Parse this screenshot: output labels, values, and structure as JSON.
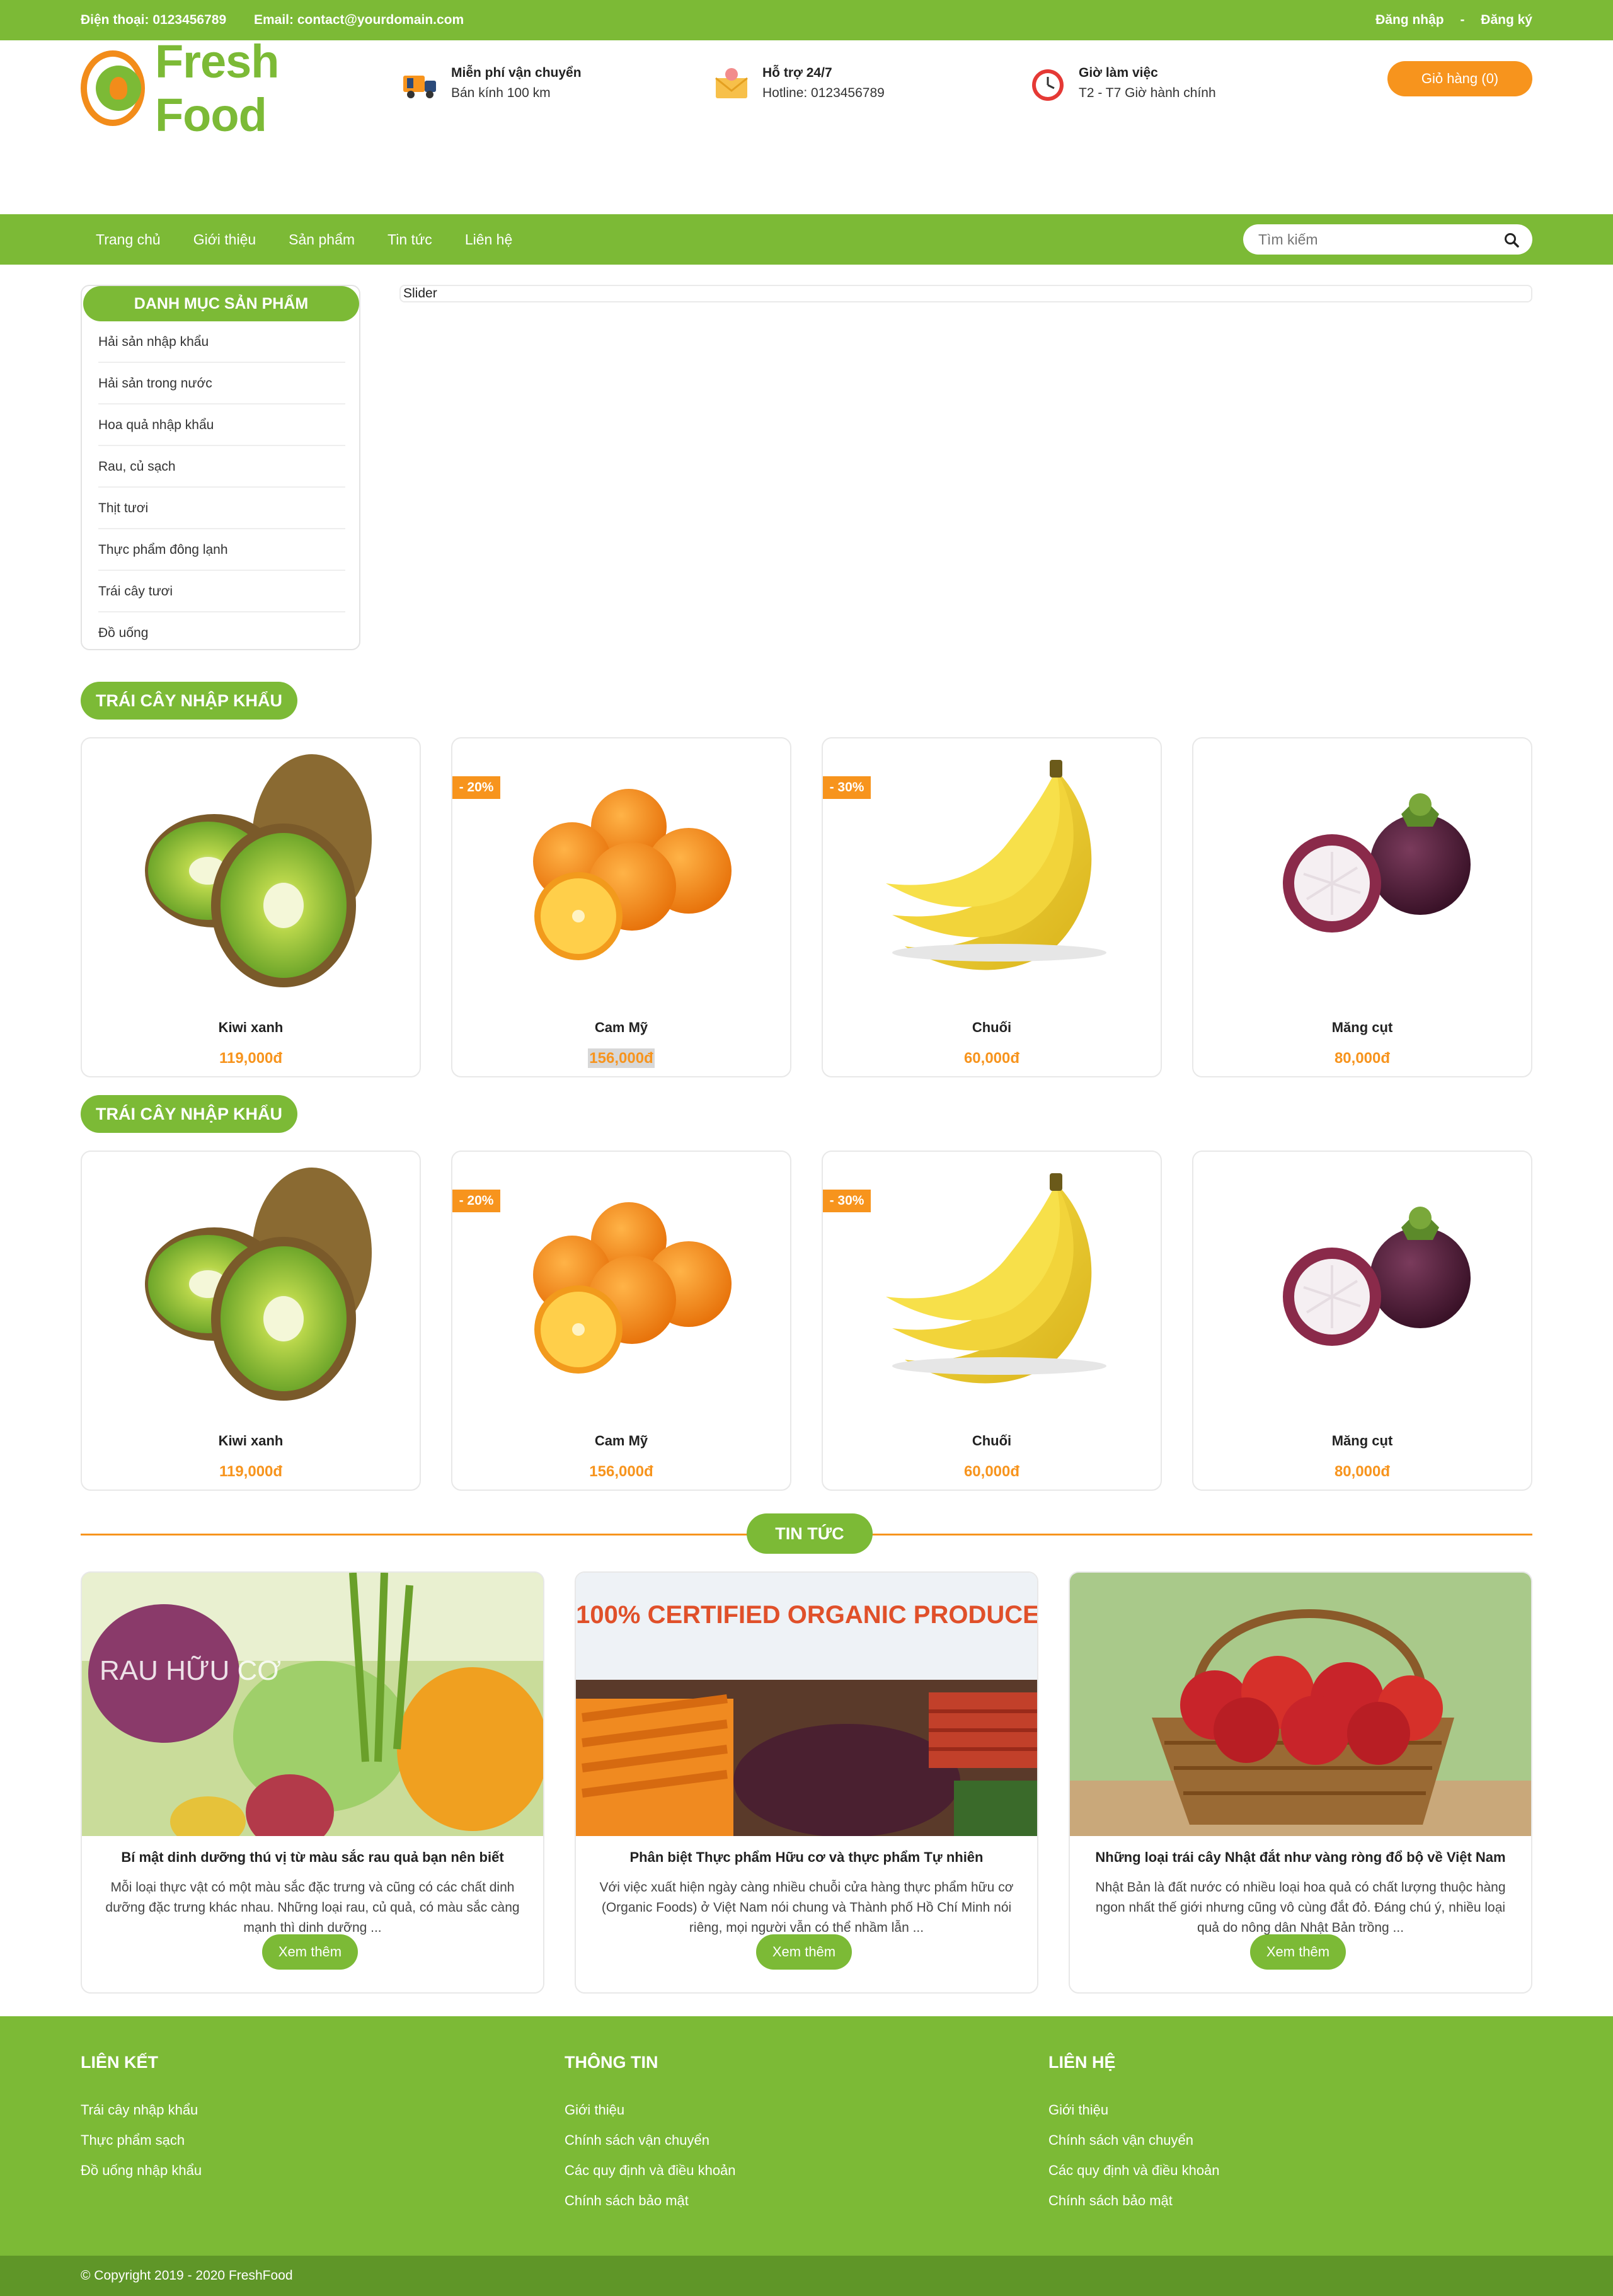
{
  "topbar": {
    "phone": "Điện thoại: 0123456789",
    "email": "Email: contact@yourdomain.com",
    "login": "Đăng nhập",
    "separator": "-",
    "register": "Đăng ký"
  },
  "header": {
    "logo_text": "Fresh Food",
    "features": [
      {
        "icon": "delivery-truck-icon",
        "title": "Miễn phí vận chuyển",
        "subtitle": "Bán kính 100 km"
      },
      {
        "icon": "support-mail-icon",
        "title": "Hỗ trợ 24/7",
        "subtitle": "Hotline: 0123456789"
      },
      {
        "icon": "clock-icon",
        "title": "Giờ làm việc",
        "subtitle": "T2 - T7 Giờ hành chính"
      }
    ],
    "cart_label": "Giỏ hàng (0)"
  },
  "nav": {
    "items": [
      "Trang chủ",
      "Giới thiệu",
      "Sản phẩm",
      "Tin tức",
      "Liên hệ"
    ],
    "search_placeholder": "Tìm kiếm"
  },
  "sidebar": {
    "title": "DANH MỤC SẢN PHẨM",
    "items": [
      "Hải sản nhập khẩu",
      "Hải sản trong nước",
      "Hoa quả nhập khẩu",
      "Rau, củ sạch",
      "Thịt tươi",
      "Thực phẩm đông lạnh",
      "Trái cây tươi",
      "Đồ uống"
    ]
  },
  "slider_label": "Slider",
  "sections": [
    {
      "title": "TRÁI CÂY NHẬP KHẨU",
      "products": [
        {
          "name": "Kiwi xanh",
          "price": "119,000đ",
          "badge": ""
        },
        {
          "name": "Cam Mỹ",
          "price": "156,000đ",
          "badge": "- 20%"
        },
        {
          "name": "Chuối",
          "price": "60,000đ",
          "badge": "- 30%"
        },
        {
          "name": "Măng cụt",
          "price": "80,000đ",
          "badge": ""
        }
      ]
    },
    {
      "title": "TRÁI CÂY NHẬP KHẨU",
      "products": [
        {
          "name": "Kiwi xanh",
          "price": "119,000đ",
          "badge": ""
        },
        {
          "name": "Cam Mỹ",
          "price": "156,000đ",
          "badge": "- 20%"
        },
        {
          "name": "Chuối",
          "price": "60,000đ",
          "badge": "- 30%"
        },
        {
          "name": "Măng cụt",
          "price": "80,000đ",
          "badge": ""
        }
      ]
    }
  ],
  "news": {
    "title": "TIN TỨC",
    "items": [
      {
        "title": "Bí mật dinh dưỡng thú vị từ màu sắc rau quả bạn nên biết",
        "desc": "Mỗi loại thực vật có một màu sắc đặc trưng và cũng có các chất dinh dưỡng đặc trưng khác nhau. Những loại rau, củ quả, có màu sắc càng mạnh thì dinh dưỡng ...",
        "image_text": "RAU HỮU CƠ",
        "button": "Xem thêm"
      },
      {
        "title": "Phân biệt Thực phẩm Hữu cơ và thực phẩm Tự nhiên",
        "desc": "Với việc xuất hiện ngày càng nhiều chuỗi cửa hàng thực phẩm hữu cơ (Organic Foods) ở Việt Nam nói chung và Thành phố Hồ Chí Minh nói riêng, mọi người vẫn có thể nhầm lẫn ...",
        "image_text": "100% CERTIFIED ORGANIC PRODUCE",
        "button": "Xem thêm"
      },
      {
        "title": "Những loại trái cây Nhật đắt như vàng ròng đổ bộ về Việt Nam",
        "desc": "Nhật Bản là đất nước có nhiều loại hoa quả có chất lượng thuộc hàng ngon nhất thế giới nhưng cũng vô cùng đắt đỏ. Đáng chú ý, nhiều loại quả do nông dân Nhật Bản trồng ...",
        "image_text": "",
        "button": "Xem thêm"
      }
    ]
  },
  "footer": {
    "columns": [
      {
        "title": "LIÊN KẾT",
        "links": [
          "Trái cây nhập khẩu",
          "Thực phẩm sạch",
          "Đồ uống nhập khẩu"
        ]
      },
      {
        "title": "THÔNG TIN",
        "links": [
          "Giới thiệu",
          "Chính sách vận chuyển",
          "Các quy định và điều khoản",
          "Chính sách bảo mật"
        ]
      },
      {
        "title": "LIÊN HỆ",
        "links": [
          "Giới thiệu",
          "Chính sách vận chuyển",
          "Các quy định và điều khoản",
          "Chính sách bảo mật"
        ]
      }
    ],
    "copyright": "© Copyright 2019 - 2020 FreshFood"
  },
  "colors": {
    "primary_green": "#7cba36",
    "accent_orange": "#f7941d",
    "dark_green": "#5f9628"
  }
}
